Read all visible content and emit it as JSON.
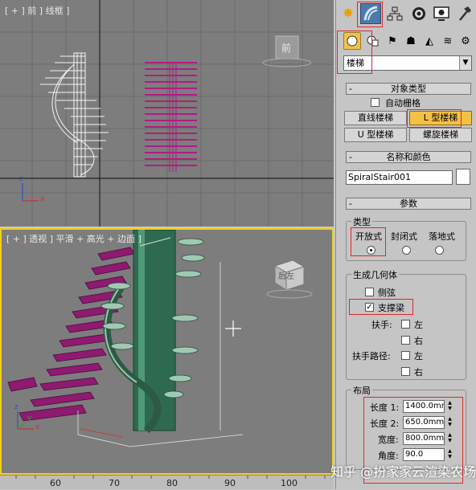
{
  "viewports": {
    "front": {
      "label": "[ + ] 前 ] 线框 ]",
      "cube_label": "前"
    },
    "perspective": {
      "label": "[ + ] 透视 ] 平滑 + 高光 + 边面 ]",
      "cube_label": "后左"
    }
  },
  "axis": {
    "x": "x",
    "y": "y",
    "z": "z"
  },
  "ruler": {
    "ticks": [
      "60",
      "70",
      "80",
      "90",
      "100"
    ]
  },
  "panel": {
    "stair_dropdown": "楼梯",
    "object_type": {
      "title": "对象类型",
      "autogrid": "自动栅格",
      "buttons": [
        "直线楼梯",
        "L 型楼梯",
        "U 型楼梯",
        "螺旋楼梯"
      ]
    },
    "name_color": {
      "title": "名称和颜色",
      "name_value": "SpiralStair001"
    },
    "params": {
      "title": "参数",
      "type_group": "类型",
      "types": [
        "开放式",
        "封闭式",
        "落地式"
      ],
      "geometry_group": "生成几何体",
      "side_string": "侧弦",
      "support_beam": "支撑梁",
      "rail_label": "扶手:",
      "rail_path_label": "扶手路径:",
      "left": "左",
      "right": "右",
      "layout_group": "布局",
      "length1_label": "长度 1:",
      "length1_value": "1400.0mm",
      "length2_label": "长度 2:",
      "length2_value": "650.0mm",
      "width_label": "宽度:",
      "width_value": "800.0mm",
      "angle_label": "角度:",
      "angle_value": "90.0"
    }
  },
  "watermark": "知乎 @扮家家云渲染农场",
  "colors": {
    "highlight": "#e0262b",
    "active_button": "#f5c145",
    "viewport_border": "#f0d020"
  }
}
